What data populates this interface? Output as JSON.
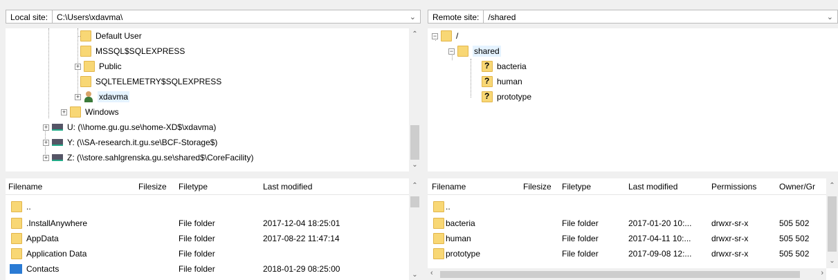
{
  "local": {
    "site_label": "Local site:",
    "site_path": "C:\\Users\\xdavma\\",
    "tree": [
      {
        "label": "Default User",
        "icon": "folder-icon"
      },
      {
        "label": "MSSQL$SQLEXPRESS",
        "icon": "folder-icon"
      },
      {
        "label": "Public",
        "icon": "folder-icon"
      },
      {
        "label": "SQLTELEMETRY$SQLEXPRESS",
        "icon": "folder-icon"
      },
      {
        "label": "xdavma",
        "icon": "user-icon"
      },
      {
        "label": "Windows",
        "icon": "folder-icon"
      },
      {
        "label": "U: (\\\\home.gu.gu.se\\home-XD$\\xdavma)",
        "icon": "drive-icon"
      },
      {
        "label": "Y: (\\\\SA-research.it.gu.se\\BCF-Storage$)",
        "icon": "drive-icon"
      },
      {
        "label": "Z: (\\\\store.sahlgrenska.gu.se\\shared$\\CoreFacility)",
        "icon": "drive-icon"
      }
    ],
    "columns": {
      "filename": "Filename",
      "filesize": "Filesize",
      "filetype": "Filetype",
      "modified": "Last modified"
    },
    "files": [
      {
        "name": "..",
        "type": "",
        "modified": ""
      },
      {
        "name": ".InstallAnywhere",
        "type": "File folder",
        "modified": "2017-12-04 18:25:01"
      },
      {
        "name": "AppData",
        "type": "File folder",
        "modified": "2017-08-22 11:47:14"
      },
      {
        "name": "Application Data",
        "type": "File folder",
        "modified": ""
      },
      {
        "name": "Contacts",
        "type": "File folder",
        "modified": "2018-01-29 08:25:00"
      }
    ]
  },
  "remote": {
    "site_label": "Remote site:",
    "site_path": "/shared",
    "tree": [
      {
        "label": "/"
      },
      {
        "label": "shared"
      },
      {
        "label": "bacteria"
      },
      {
        "label": "human"
      },
      {
        "label": "prototype"
      }
    ],
    "columns": {
      "filename": "Filename",
      "filesize": "Filesize",
      "filetype": "Filetype",
      "modified": "Last modified",
      "permissions": "Permissions",
      "owner": "Owner/Gr"
    },
    "files": [
      {
        "name": "..",
        "type": "",
        "modified": "",
        "perms": "",
        "owner": ""
      },
      {
        "name": "bacteria",
        "type": "File folder",
        "modified": "2017-01-20 10:...",
        "perms": "drwxr-sr-x",
        "owner": "505 502"
      },
      {
        "name": "human",
        "type": "File folder",
        "modified": "2017-04-11 10:...",
        "perms": "drwxr-sr-x",
        "owner": "505 502"
      },
      {
        "name": "prototype",
        "type": "File folder",
        "modified": "2017-09-08 12:...",
        "perms": "drwxr-sr-x",
        "owner": "505 502"
      }
    ]
  }
}
